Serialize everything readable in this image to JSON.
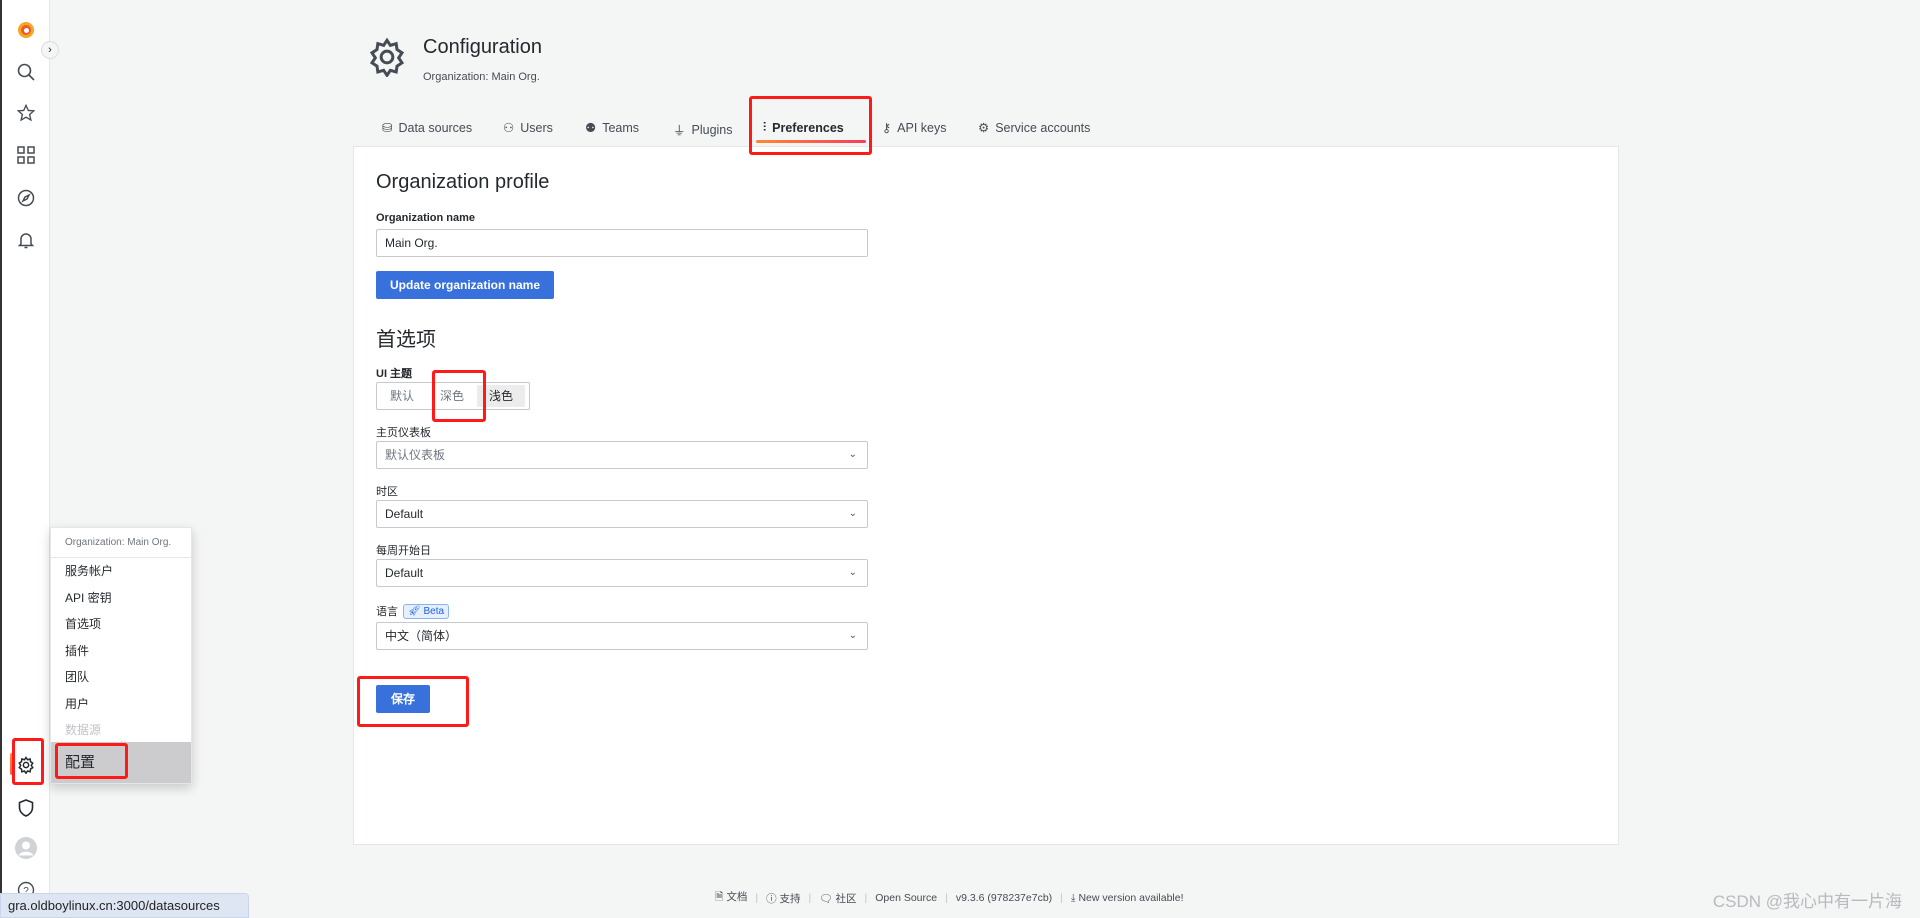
{
  "header": {
    "title": "Configuration",
    "subtitle": "Organization: Main Org."
  },
  "tabs": [
    {
      "label": "Data sources",
      "icon": "database-icon"
    },
    {
      "label": "Users",
      "icon": "user-icon"
    },
    {
      "label": "Teams",
      "icon": "users-icon"
    },
    {
      "label": "Plugins",
      "icon": "plug-icon"
    },
    {
      "label": "Preferences",
      "icon": "sliders-icon",
      "active": true
    },
    {
      "label": "API keys",
      "icon": "key-icon"
    },
    {
      "label": "Service accounts",
      "icon": "user-cog-icon"
    }
  ],
  "org": {
    "heading": "Organization profile",
    "name_label": "Organization name",
    "name_value": "Main Org.",
    "update_button": "Update organization name"
  },
  "prefs": {
    "heading": "首选项",
    "theme_label": "UI 主题",
    "theme_options": [
      "默认",
      "深色",
      "浅色"
    ],
    "theme_selected": "浅色",
    "home_label": "主页仪表板",
    "home_value": "默认仪表板",
    "tz_label": "时区",
    "tz_value": "Default",
    "week_label": "每周开始日",
    "week_value": "Default",
    "lang_label": "语言",
    "beta": "Beta",
    "lang_value": "中文（简体）",
    "save": "保存"
  },
  "menu": {
    "header": "Organization: Main Org.",
    "items": [
      "服务帐户",
      "API 密钥",
      "首选项",
      "插件",
      "团队",
      "用户",
      "数据源"
    ],
    "selected": "配置"
  },
  "footer": {
    "docs": "文档",
    "support": "支持",
    "community": "社区",
    "open_source": "Open Source",
    "version": "v9.3.6 (978237e7cb)",
    "new_version": "New version available!"
  },
  "status_url": "gra.oldboylinux.cn:3000/datasources",
  "watermark": "CSDN @我心中有一片海",
  "colors": {
    "primary": "#3871dc",
    "brand_orange": "#f55f3e",
    "annotation": "#ff1a1a"
  }
}
